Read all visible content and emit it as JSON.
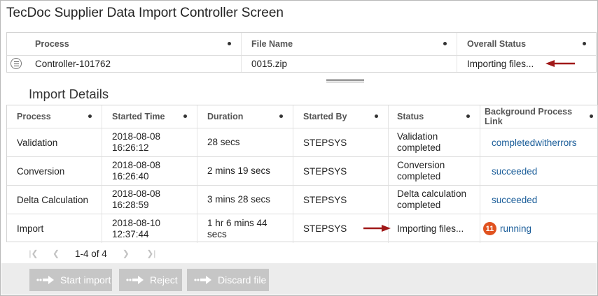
{
  "title": "TecDoc Supplier Data Import Controller Screen",
  "controller": {
    "headers": [
      "Process",
      "File Name",
      "Overall Status"
    ],
    "row": {
      "process": "Controller-101762",
      "file_name": "0015.zip",
      "overall_status": "Importing files..."
    }
  },
  "import_details": {
    "title": "Import Details",
    "headers": [
      "Process",
      "Started Time",
      "Duration",
      "Started By",
      "Status",
      "Background Process Link"
    ],
    "rows": [
      {
        "process": "Validation",
        "started_date": "2018-08-08",
        "started_clock": "16:26:12",
        "duration1": "28 secs",
        "duration2": "",
        "started_by": "STEPSYS",
        "status1": "Validation",
        "status2": "completed",
        "link": "completedwitherrors",
        "badge": ""
      },
      {
        "process": "Conversion",
        "started_date": "2018-08-08",
        "started_clock": "16:26:40",
        "duration1": "2 mins 19 secs",
        "duration2": "",
        "started_by": "STEPSYS",
        "status1": "Conversion",
        "status2": "completed",
        "link": "succeeded",
        "badge": ""
      },
      {
        "process": "Delta Calculation",
        "started_date": "2018-08-08",
        "started_clock": "16:28:59",
        "duration1": "3 mins 28 secs",
        "duration2": "",
        "started_by": "STEPSYS",
        "status1": "Delta calculation",
        "status2": "completed",
        "link": "succeeded",
        "badge": ""
      },
      {
        "process": "Import",
        "started_date": "2018-08-10",
        "started_clock": "12:37:44",
        "duration1": "1 hr 6 mins 44",
        "duration2": "secs",
        "started_by": "STEPSYS",
        "status1": "Importing files...",
        "status2": "",
        "link": "running",
        "badge": "11"
      }
    ]
  },
  "pager": {
    "text": "1-4 of 4"
  },
  "buttons": {
    "start_import": "Start import",
    "reject": "Reject",
    "discard_file": "Discard file"
  },
  "colors": {
    "link": "#1a5d99",
    "badge": "#e0521f",
    "annotation_arrow": "#a01818",
    "button_disabled": "#c6c6c6"
  }
}
